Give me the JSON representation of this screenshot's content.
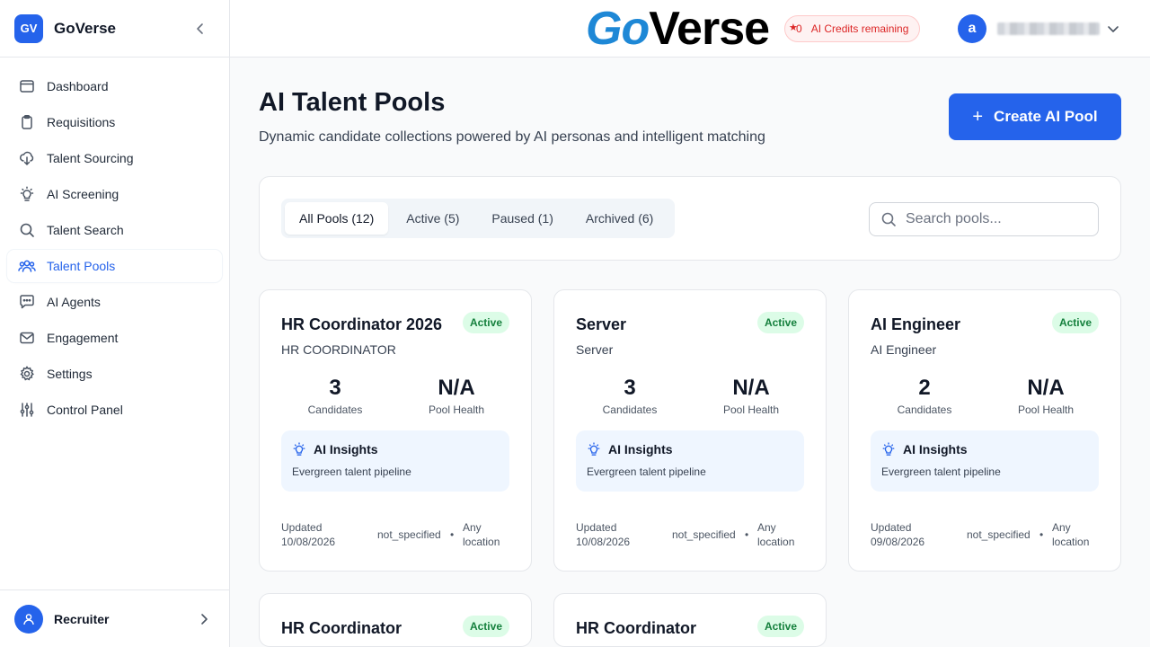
{
  "app": {
    "badge": "GV",
    "name": "GoVerse"
  },
  "sidebar": {
    "items": [
      {
        "label": "Dashboard",
        "icon": "browser-window-icon"
      },
      {
        "label": "Requisitions",
        "icon": "clipboard-icon"
      },
      {
        "label": "Talent Sourcing",
        "icon": "cloud-download-icon"
      },
      {
        "label": "AI Screening",
        "icon": "lightbulb-icon"
      },
      {
        "label": "Talent Search",
        "icon": "search-icon"
      },
      {
        "label": "Talent Pools",
        "icon": "users-icon"
      },
      {
        "label": "AI Agents",
        "icon": "chat-bubble-icon"
      },
      {
        "label": "Engagement",
        "icon": "mail-icon"
      },
      {
        "label": "Settings",
        "icon": "gear-icon"
      },
      {
        "label": "Control Panel",
        "icon": "sliders-icon"
      }
    ],
    "active_item": "Talent Pools",
    "user": {
      "role": "Recruiter"
    }
  },
  "topbar": {
    "logo": {
      "part1": "Go",
      "part2": "Verse"
    },
    "credits": {
      "count": "0",
      "label": "AI Credits remaining"
    },
    "avatar_letter": "a"
  },
  "page": {
    "title": "AI Talent Pools",
    "subtitle": "Dynamic candidate collections powered by AI personas and intelligent matching",
    "create_button": "Create AI Pool"
  },
  "filters": {
    "tabs": [
      {
        "label": "All Pools (12)",
        "active": true
      },
      {
        "label": "Active (5)",
        "active": false
      },
      {
        "label": "Paused (1)",
        "active": false
      },
      {
        "label": "Archived (6)",
        "active": false
      }
    ],
    "search_placeholder": "Search pools..."
  },
  "pools": [
    {
      "title": "HR Coordinator 2026",
      "status": "Active",
      "role": "HR COORDINATOR",
      "candidates": "3",
      "candidates_label": "Candidates",
      "health": "N/A",
      "health_label": "Pool Health",
      "insights_title": "AI Insights",
      "insights_text": "Evergreen talent pipeline",
      "updated_label": "Updated",
      "updated_date": "10/08/2026",
      "employment": "not_specified",
      "separator": "•",
      "location_line1": "Any",
      "location_line2": "location"
    },
    {
      "title": "Server",
      "status": "Active",
      "role": "Server",
      "candidates": "3",
      "candidates_label": "Candidates",
      "health": "N/A",
      "health_label": "Pool Health",
      "insights_title": "AI Insights",
      "insights_text": "Evergreen talent pipeline",
      "updated_label": "Updated",
      "updated_date": "10/08/2026",
      "employment": "not_specified",
      "separator": "•",
      "location_line1": "Any",
      "location_line2": "location"
    },
    {
      "title": "AI Engineer",
      "status": "Active",
      "role": "AI Engineer",
      "candidates": "2",
      "candidates_label": "Candidates",
      "health": "N/A",
      "health_label": "Pool Health",
      "insights_title": "AI Insights",
      "insights_text": "Evergreen talent pipeline",
      "updated_label": "Updated",
      "updated_date": "09/08/2026",
      "employment": "not_specified",
      "separator": "•",
      "location_line1": "Any",
      "location_line2": "location"
    },
    {
      "title": "HR Coordinator",
      "status": "Active"
    },
    {
      "title": "HR Coordinator",
      "status": "Active"
    }
  ],
  "colors": {
    "accent": "#2563eb",
    "active_badge_bg": "#dcfce7",
    "active_badge_text": "#15803d",
    "credits_text": "#dc2626"
  }
}
